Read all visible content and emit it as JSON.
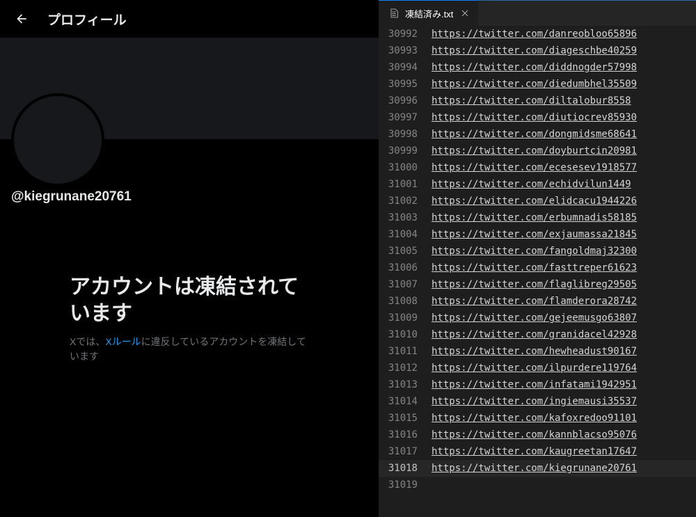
{
  "left": {
    "header_title": "プロフィール",
    "handle": "@kiegrunane20761",
    "suspended_title": "アカウントは凍結されています",
    "suspended_msg_before": "Xでは、",
    "suspended_rules_link": "Xルール",
    "suspended_msg_after": "に違反しているアカウントを凍結しています"
  },
  "editor": {
    "tab_title": "凍結済み.txt",
    "current_line_index": 26,
    "lines": [
      {
        "num": 30992,
        "url": "https://twitter.com/danreobloo65896"
      },
      {
        "num": 30993,
        "url": "https://twitter.com/diageschbe40259"
      },
      {
        "num": 30994,
        "url": "https://twitter.com/diddnogder57998"
      },
      {
        "num": 30995,
        "url": "https://twitter.com/diedumbhel35509"
      },
      {
        "num": 30996,
        "url": "https://twitter.com/diltalobur8558"
      },
      {
        "num": 30997,
        "url": "https://twitter.com/diutiocrev85930"
      },
      {
        "num": 30998,
        "url": "https://twitter.com/dongmidsme68641"
      },
      {
        "num": 30999,
        "url": "https://twitter.com/doyburtcin20981"
      },
      {
        "num": 31000,
        "url": "https://twitter.com/ecesesev1918577"
      },
      {
        "num": 31001,
        "url": "https://twitter.com/echidvilun1449"
      },
      {
        "num": 31002,
        "url": "https://twitter.com/elidcacu1944226"
      },
      {
        "num": 31003,
        "url": "https://twitter.com/erbumnadis58185"
      },
      {
        "num": 31004,
        "url": "https://twitter.com/exjaumassa21845"
      },
      {
        "num": 31005,
        "url": "https://twitter.com/fangoldmaj32300"
      },
      {
        "num": 31006,
        "url": "https://twitter.com/fasttreper61623"
      },
      {
        "num": 31007,
        "url": "https://twitter.com/flaglibreg29505"
      },
      {
        "num": 31008,
        "url": "https://twitter.com/flamderora28742"
      },
      {
        "num": 31009,
        "url": "https://twitter.com/gejeemusgo63807"
      },
      {
        "num": 31010,
        "url": "https://twitter.com/granidacel42928"
      },
      {
        "num": 31011,
        "url": "https://twitter.com/hewheadust90167"
      },
      {
        "num": 31012,
        "url": "https://twitter.com/ilpurdere119764"
      },
      {
        "num": 31013,
        "url": "https://twitter.com/infatami1942951"
      },
      {
        "num": 31014,
        "url": "https://twitter.com/ingiemausi35537"
      },
      {
        "num": 31015,
        "url": "https://twitter.com/kafoxredoo91101"
      },
      {
        "num": 31016,
        "url": "https://twitter.com/kannblacso95076"
      },
      {
        "num": 31017,
        "url": "https://twitter.com/kaugreetan17647"
      },
      {
        "num": 31018,
        "url": "https://twitter.com/kiegrunane20761"
      },
      {
        "num": 31019,
        "url": ""
      }
    ]
  }
}
